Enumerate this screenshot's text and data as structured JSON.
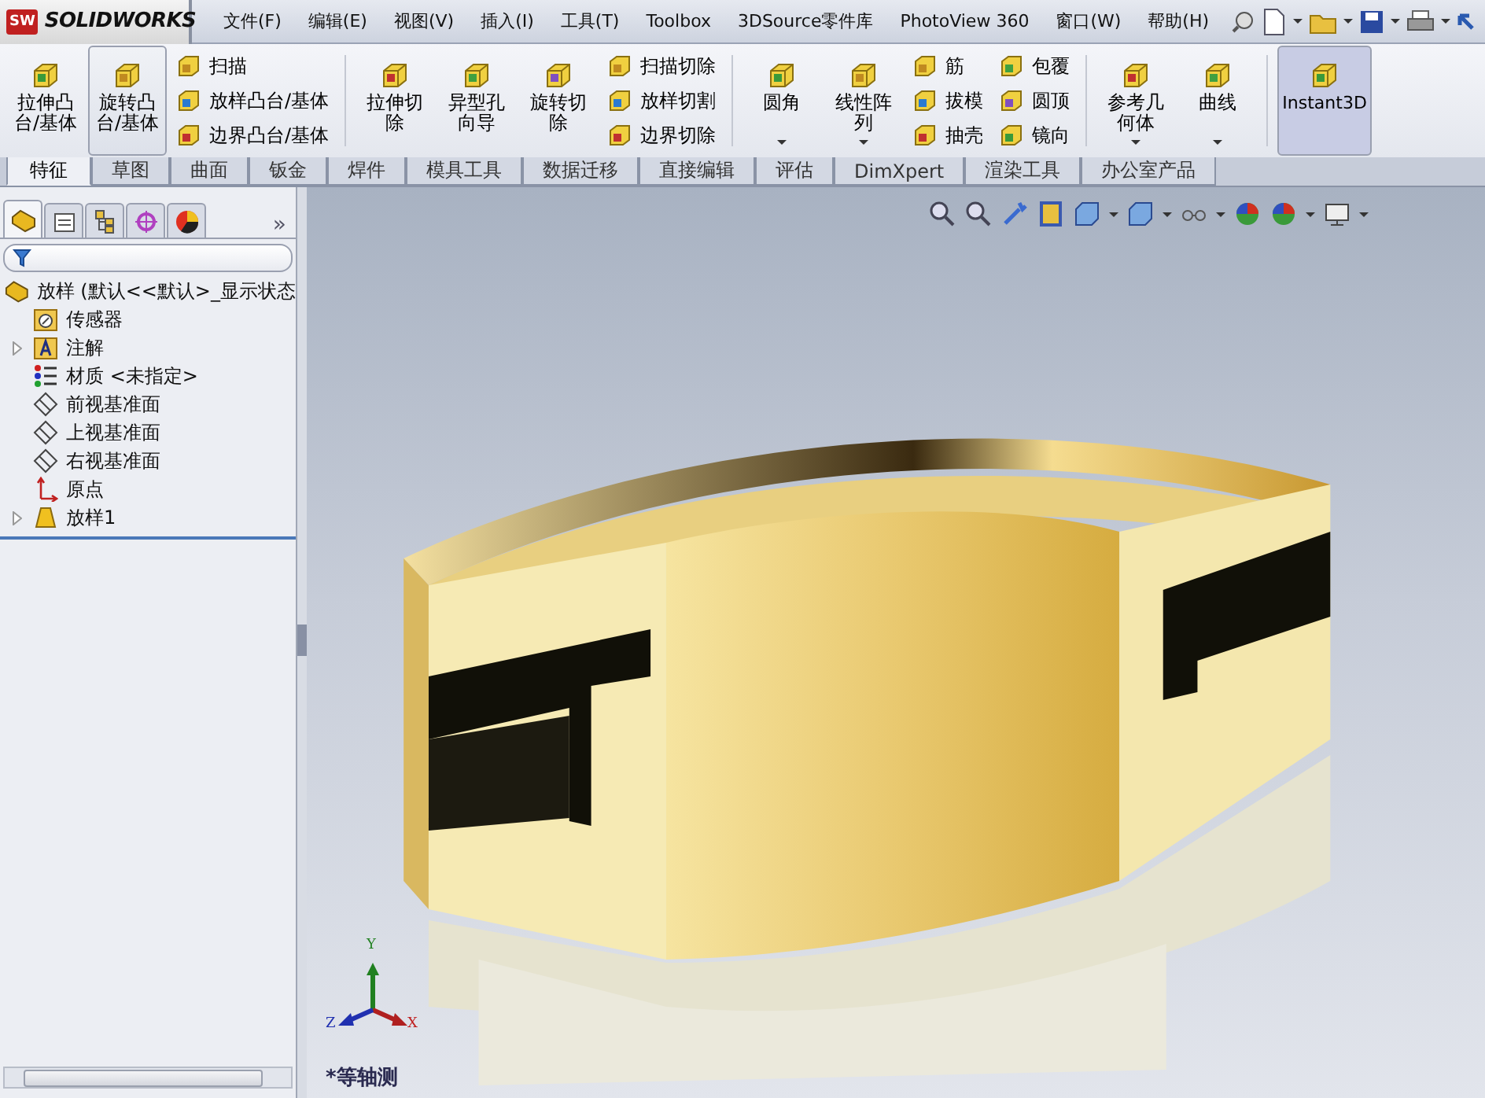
{
  "app": {
    "badge": "SW",
    "logo": "SOLIDWORKS"
  },
  "menu": [
    "文件(F)",
    "编辑(E)",
    "视图(V)",
    "插入(I)",
    "工具(T)",
    "Toolbox",
    "3DSource零件库",
    "PhotoView 360",
    "窗口(W)",
    "帮助(H)"
  ],
  "toolbar": {
    "sections": [
      {
        "tools": [
          {
            "kind": "large",
            "label": "拉伸凸台/基体",
            "selected": false,
            "dropdown": false
          },
          {
            "kind": "large",
            "label": "旋转凸台/基体",
            "selected": true,
            "dropdown": false
          },
          {
            "kind": "stack",
            "items": [
              "扫描",
              "放样凸台/基体",
              "边界凸台/基体"
            ]
          }
        ]
      },
      {
        "tools": [
          {
            "kind": "large",
            "label": "拉伸切除",
            "selected": false,
            "dropdown": false
          },
          {
            "kind": "large",
            "label": "异型孔向导",
            "selected": false,
            "dropdown": false
          },
          {
            "kind": "large",
            "label": "旋转切除",
            "selected": false,
            "dropdown": false
          },
          {
            "kind": "stack",
            "items": [
              "扫描切除",
              "放样切割",
              "边界切除"
            ]
          }
        ]
      },
      {
        "tools": [
          {
            "kind": "large",
            "label": "圆角",
            "selected": false,
            "dropdown": true
          },
          {
            "kind": "large",
            "label": "线性阵列",
            "selected": false,
            "dropdown": true
          },
          {
            "kind": "stack",
            "items": [
              "筋",
              "拔模",
              "抽壳"
            ]
          },
          {
            "kind": "stack",
            "items": [
              "包覆",
              "圆顶",
              "镜向"
            ]
          }
        ]
      },
      {
        "tools": [
          {
            "kind": "large",
            "label": "参考几何体",
            "selected": false,
            "dropdown": true
          },
          {
            "kind": "large",
            "label": "曲线",
            "selected": false,
            "dropdown": true
          }
        ]
      },
      {
        "tools": [
          {
            "kind": "large",
            "label": "Instant3D",
            "selected": true,
            "dropdown": false
          }
        ]
      }
    ]
  },
  "tabs": [
    {
      "label": "特征",
      "selected": true
    },
    {
      "label": "草图",
      "selected": false
    },
    {
      "label": "曲面",
      "selected": false
    },
    {
      "label": "钣金",
      "selected": false
    },
    {
      "label": "焊件",
      "selected": false
    },
    {
      "label": "模具工具",
      "selected": false
    },
    {
      "label": "数据迁移",
      "selected": false
    },
    {
      "label": "直接编辑",
      "selected": false
    },
    {
      "label": "评估",
      "selected": false
    },
    {
      "label": "DimXpert",
      "selected": false
    },
    {
      "label": "渲染工具",
      "selected": false
    },
    {
      "label": "办公室产品",
      "selected": false
    }
  ],
  "panel": {
    "tabs": [
      {
        "selected": true
      },
      {
        "selected": false
      },
      {
        "selected": false
      },
      {
        "selected": false
      },
      {
        "selected": false
      }
    ],
    "more": "»",
    "tree": {
      "label": "放样  (默认<<默认>_显示状态",
      "children": [
        {
          "kind": "sensor",
          "label": "传感器",
          "expandable": false
        },
        {
          "kind": "annotation",
          "label": "注解",
          "expandable": true
        },
        {
          "kind": "material",
          "label": "材质 <未指定>",
          "expandable": false
        },
        {
          "kind": "plane",
          "label": "前视基准面",
          "expandable": false
        },
        {
          "kind": "plane",
          "label": "上视基准面",
          "expandable": false
        },
        {
          "kind": "plane",
          "label": "右视基准面",
          "expandable": false
        },
        {
          "kind": "origin",
          "label": "原点",
          "expandable": false
        },
        {
          "kind": "feature",
          "label": "放样1",
          "expandable": true
        }
      ]
    }
  },
  "viewport": {
    "triad": {
      "y": "Y",
      "x": "X",
      "z": "Z"
    },
    "view_label": "*等轴测"
  }
}
